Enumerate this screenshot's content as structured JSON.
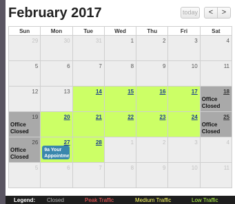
{
  "calendar": {
    "title": "February 2017",
    "buttons": {
      "today": "today",
      "prev": "<",
      "next": ">"
    },
    "weekdays": [
      "Sun",
      "Mon",
      "Tue",
      "Wed",
      "Thu",
      "Fri",
      "Sat"
    ],
    "closed_label": "Office Closed",
    "event": {
      "time": "9a",
      "title": "Your Appointment"
    },
    "weeks": [
      [
        {
          "d": "29",
          "t": "other"
        },
        {
          "d": "30",
          "t": "other"
        },
        {
          "d": "31",
          "t": "other"
        },
        {
          "d": "1",
          "t": "normal"
        },
        {
          "d": "2",
          "t": "normal"
        },
        {
          "d": "3",
          "t": "normal"
        },
        {
          "d": "4",
          "t": "normal"
        }
      ],
      [
        {
          "d": "5",
          "t": "normal"
        },
        {
          "d": "6",
          "t": "normal"
        },
        {
          "d": "7",
          "t": "normal"
        },
        {
          "d": "8",
          "t": "normal"
        },
        {
          "d": "9",
          "t": "normal"
        },
        {
          "d": "10",
          "t": "normal"
        },
        {
          "d": "11",
          "t": "normal"
        }
      ],
      [
        {
          "d": "12",
          "t": "normal"
        },
        {
          "d": "13",
          "t": "normal"
        },
        {
          "d": "14",
          "t": "peak"
        },
        {
          "d": "15",
          "t": "peak"
        },
        {
          "d": "16",
          "t": "peak"
        },
        {
          "d": "17",
          "t": "peak"
        },
        {
          "d": "18",
          "t": "closed"
        }
      ],
      [
        {
          "d": "19",
          "t": "closed"
        },
        {
          "d": "20",
          "t": "peak"
        },
        {
          "d": "21",
          "t": "peak"
        },
        {
          "d": "22",
          "t": "peak"
        },
        {
          "d": "23",
          "t": "peak"
        },
        {
          "d": "24",
          "t": "peak"
        },
        {
          "d": "25",
          "t": "closed"
        }
      ],
      [
        {
          "d": "26",
          "t": "closed"
        },
        {
          "d": "27",
          "t": "peak",
          "event": true
        },
        {
          "d": "28",
          "t": "peak"
        },
        {
          "d": "1",
          "t": "other"
        },
        {
          "d": "2",
          "t": "other"
        },
        {
          "d": "3",
          "t": "other"
        },
        {
          "d": "4",
          "t": "other"
        }
      ],
      [
        {
          "d": "5",
          "t": "other"
        },
        {
          "d": "6",
          "t": "other"
        },
        {
          "d": "7",
          "t": "other"
        },
        {
          "d": "8",
          "t": "other"
        },
        {
          "d": "9",
          "t": "other"
        },
        {
          "d": "10",
          "t": "other"
        },
        {
          "d": "11",
          "t": "other"
        }
      ]
    ]
  },
  "legend": {
    "title": "Legend:",
    "closed": "Closed",
    "peak": "Peak Traffic",
    "medium": "Medium Traffic",
    "low": "Low Traffic"
  },
  "colors": {
    "peak_day": "#ccff66",
    "closed_day": "#a9a9a9",
    "event": "#3a87ad",
    "legend_peak": "#ff5c5c",
    "legend_medium": "#ffff66",
    "legend_low": "#b6ff4d"
  }
}
